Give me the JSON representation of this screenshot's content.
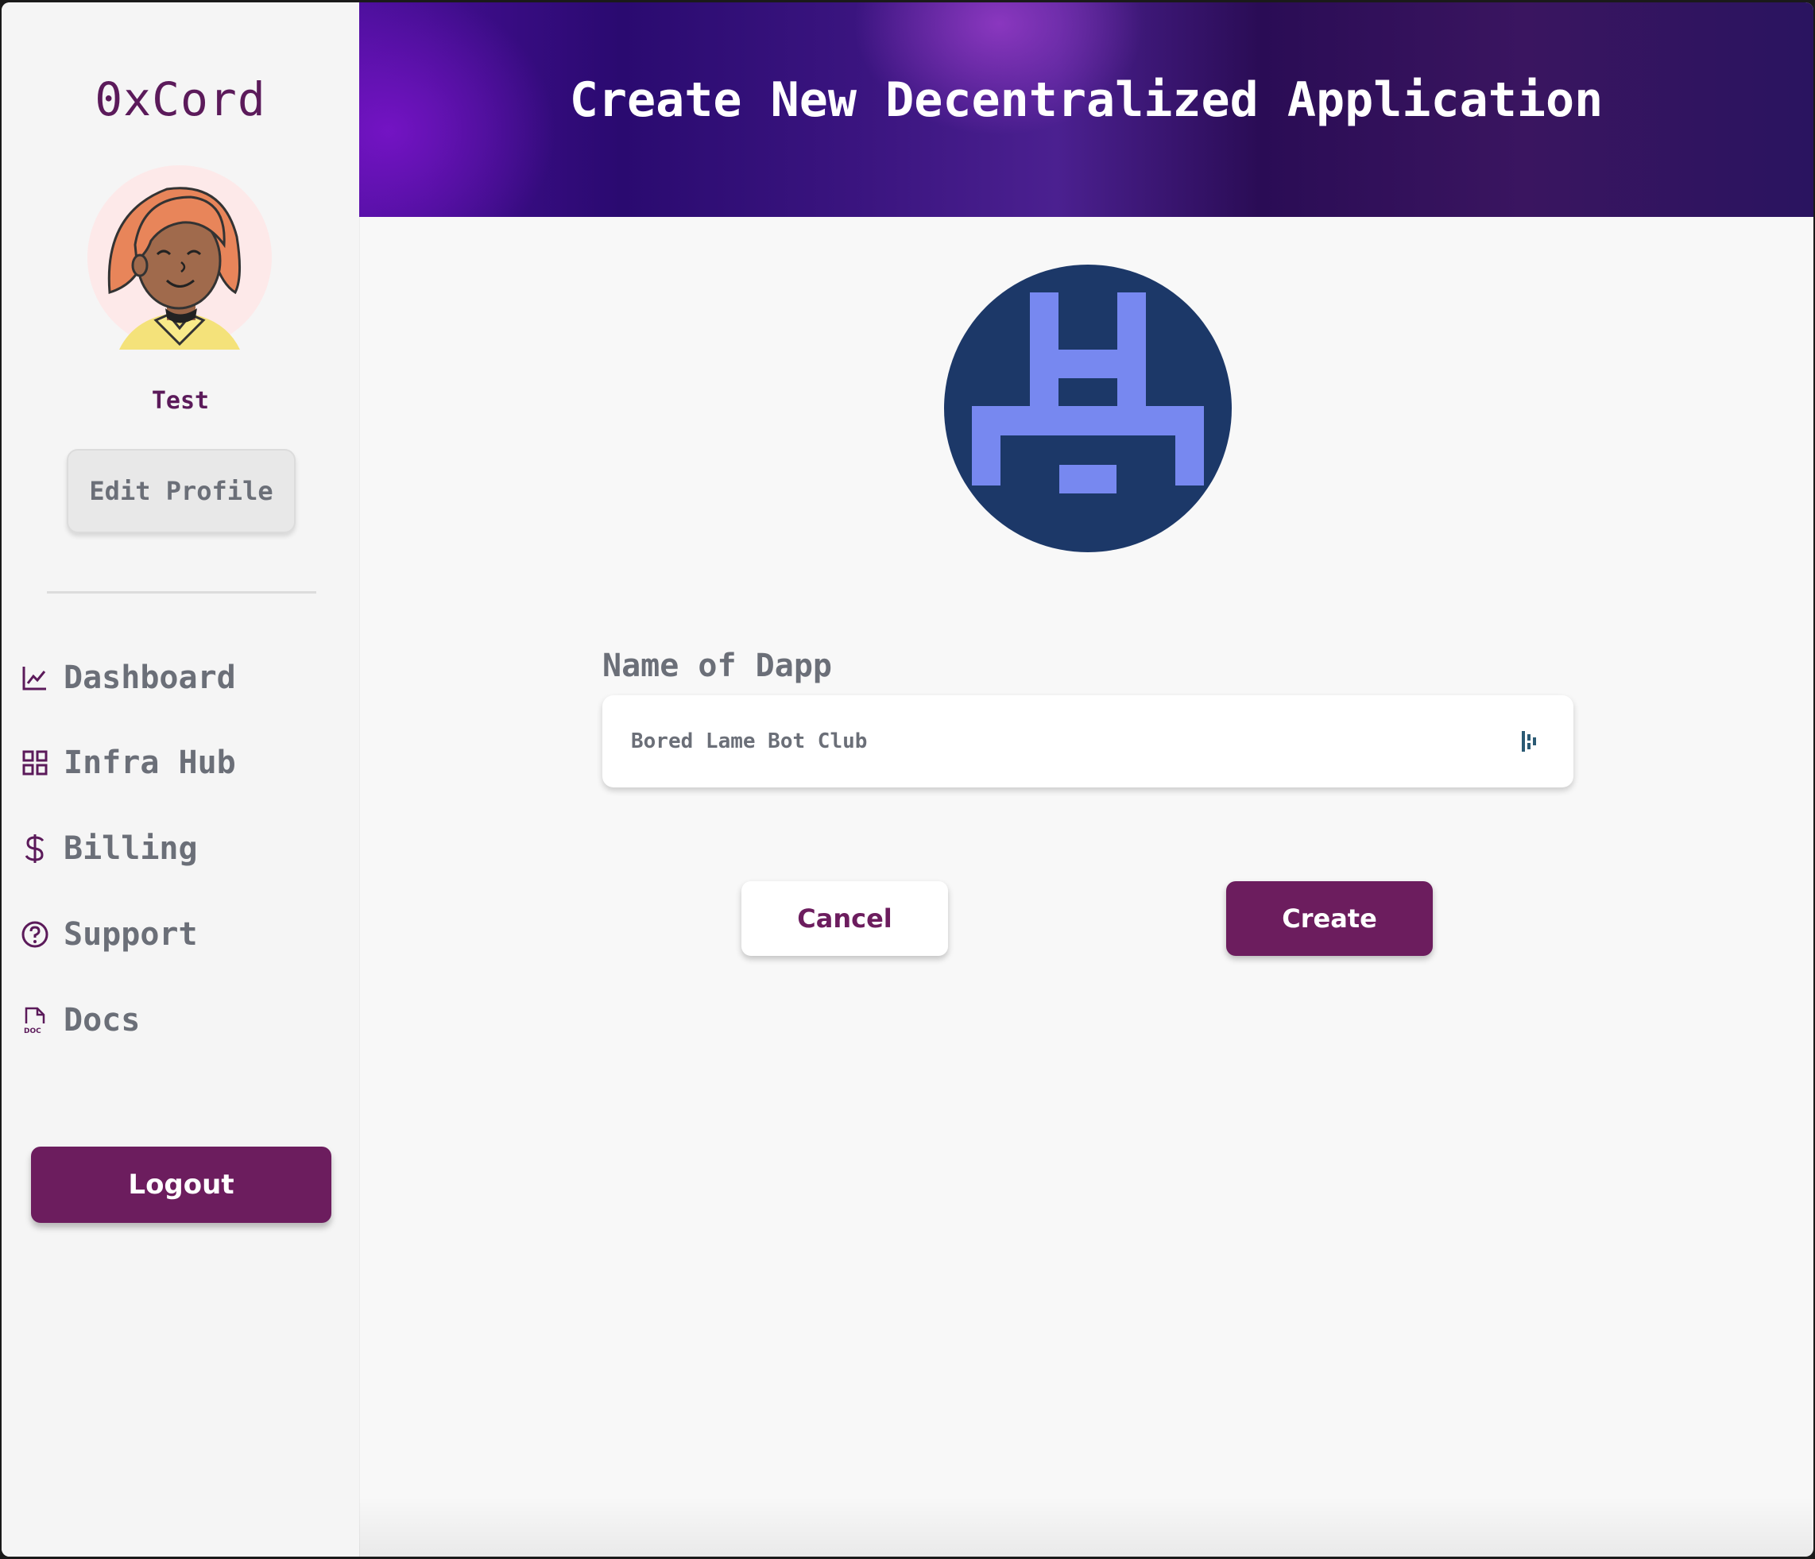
{
  "sidebar": {
    "brand": "0xCord",
    "user_name": "Test",
    "edit_profile_label": "Edit Profile",
    "nav": [
      {
        "label": "Dashboard",
        "icon": "chart-line-icon"
      },
      {
        "label": "Infra Hub",
        "icon": "grid-icon"
      },
      {
        "label": "Billing",
        "icon": "dollar-icon"
      },
      {
        "label": "Support",
        "icon": "help-circle-icon"
      },
      {
        "label": "Docs",
        "icon": "doc-icon"
      }
    ],
    "logout_label": "Logout"
  },
  "header": {
    "title": "Create New Decentralized Application"
  },
  "form": {
    "field_label": "Name of Dapp",
    "name_value": "Bored Lame Bot Club",
    "cancel_label": "Cancel",
    "create_label": "Create"
  },
  "colors": {
    "accent": "#6c1d5e",
    "brand_text": "#5b1a5a",
    "logo_bg": "#1c3868",
    "logo_fg": "#7788f0"
  }
}
